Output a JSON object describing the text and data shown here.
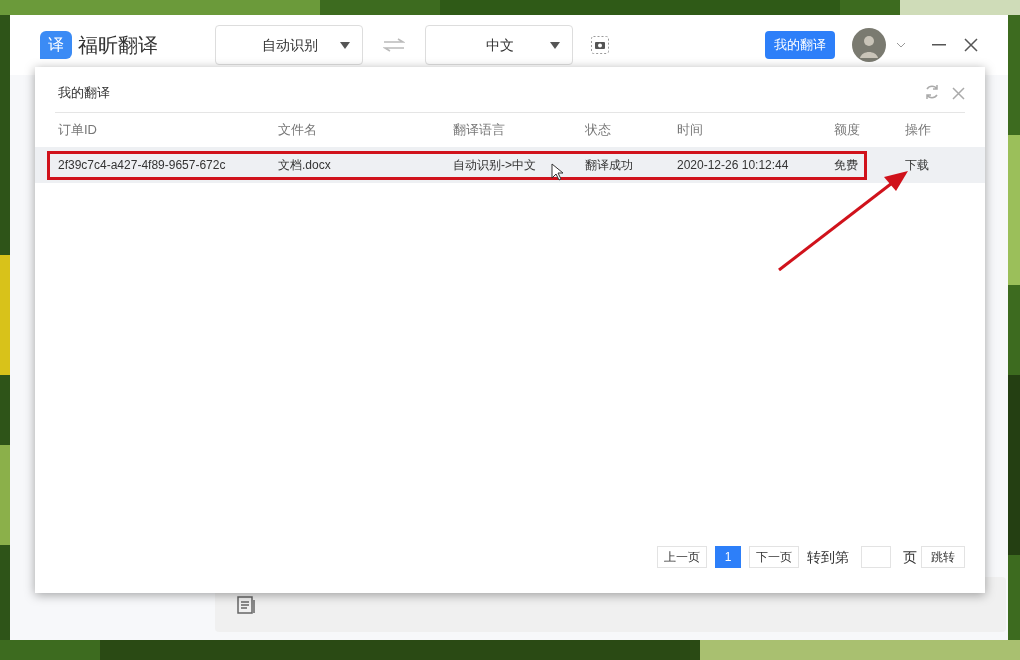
{
  "app": {
    "logo_glyph": "译",
    "name": "福昕翻译",
    "source_language": "自动识别",
    "target_language": "中文",
    "my_translations_button": "我的翻译"
  },
  "dialog": {
    "title": "我的翻译",
    "columns": [
      "订单ID",
      "文件名",
      "翻译语言",
      "状态",
      "时间",
      "额度",
      "操作"
    ],
    "rows": [
      {
        "selected": true,
        "cells": [
          "2f39c7c4-a427-4f89-9657-672c",
          "文档.docx",
          "自动识别->中文",
          "翻译成功",
          "2020-12-26 10:12:44",
          "免费"
        ],
        "action": "下载"
      }
    ],
    "pagination": {
      "prev": "上一页",
      "pages": [
        {
          "label": "1",
          "selected": true
        }
      ],
      "next": "下一页",
      "goto_label": "转到第",
      "page_unit": "页",
      "jump": "跳转"
    }
  }
}
